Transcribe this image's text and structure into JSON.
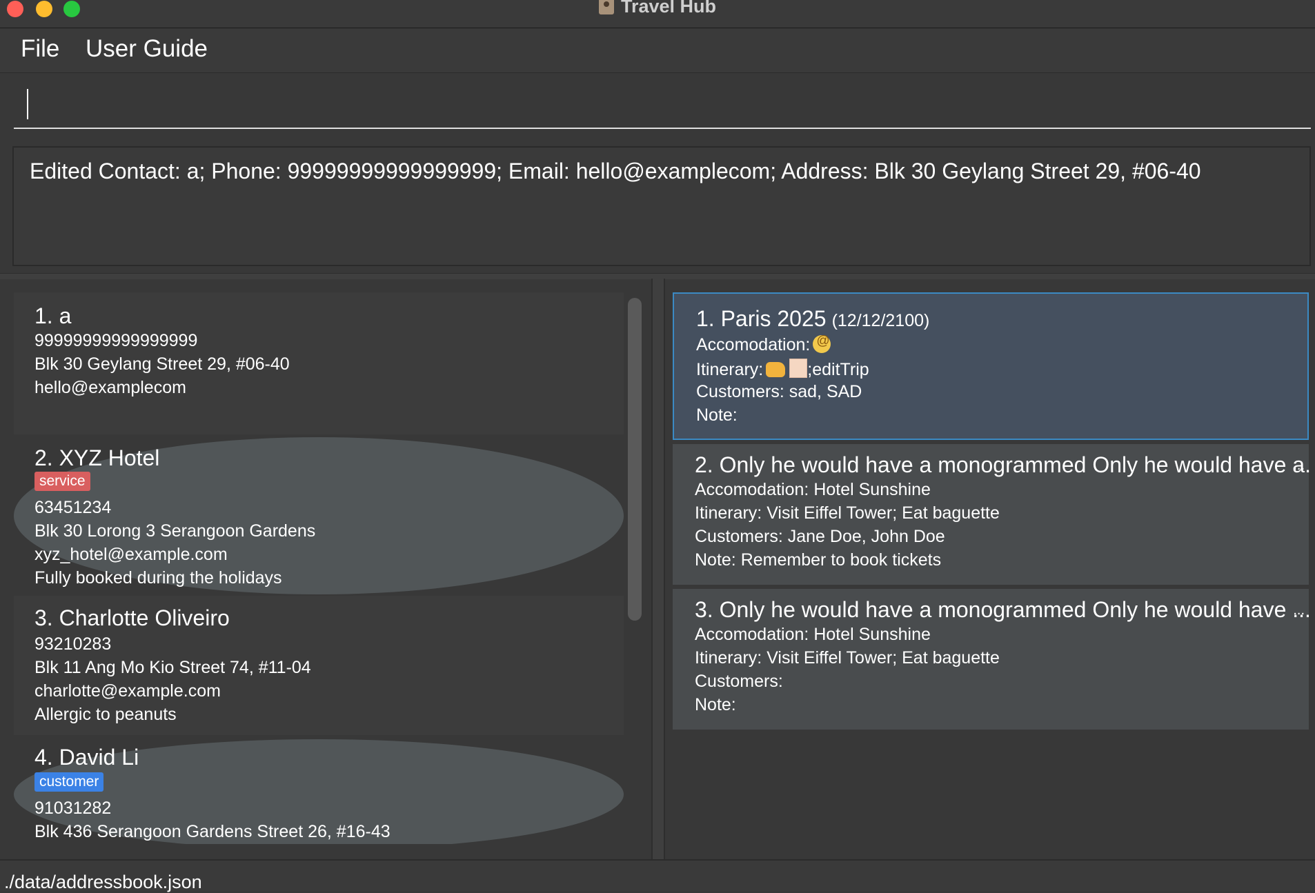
{
  "window": {
    "title": "Travel Hub",
    "app_icon": "contact-book-icon"
  },
  "menu": {
    "file": "File",
    "user_guide": "User Guide"
  },
  "command_box": {
    "value": ""
  },
  "result": {
    "text": "Edited Contact: a; Phone: 99999999999999999; Email: hello@examplecom; Address: Blk 30 Geylang Street 29, #06-40"
  },
  "contacts": [
    {
      "name": "1. a",
      "phone": "99999999999999999",
      "address": "Blk 30 Geylang Street 29, #06-40",
      "email": "hello@examplecom"
    },
    {
      "name": "2. XYZ Hotel",
      "tag": "service",
      "phone": "63451234",
      "address": "Blk 30 Lorong 3 Serangoon Gardens",
      "email": "xyz_hotel@example.com",
      "note": "Fully booked during the holidays"
    },
    {
      "name": "3. Charlotte Oliveiro",
      "phone": "93210283",
      "address": "Blk 11 Ang Mo Kio Street 74, #11-04",
      "email": "charlotte@example.com",
      "note": "Allergic to peanuts"
    },
    {
      "name": "4. David Li",
      "tag": "customer",
      "phone": "91031282",
      "address": "Blk 436 Serangoon Gardens Street 26, #16-43"
    }
  ],
  "trips": [
    {
      "title": "1.  Paris 2025",
      "date": "(12/12/2100)",
      "accomodation": "Accomodation:",
      "itinerary_label": "Itinerary:",
      "itinerary_text": ";editTrip",
      "customers": "Customers: sad, SAD",
      "note": "Note:"
    },
    {
      "title": "2.  Only he would have a monogrammed Only he would have a...",
      "ellipsis": "...",
      "accomodation": "Accomodation: Hotel Sunshine",
      "itinerary": "Itinerary: Visit Eiffel Tower; Eat baguette",
      "customers": "Customers: Jane Doe, John Doe",
      "note": "Note: Remember to book tickets"
    },
    {
      "title": "3.  Only he would have a monogrammed Only he would have ...",
      "ellipsis": "...",
      "accomodation": "Accomodation: Hotel Sunshine",
      "itinerary": "Itinerary: Visit Eiffel Tower; Eat baguette",
      "customers": "Customers:",
      "note": "Note:"
    }
  ],
  "status": {
    "path": "./data/addressbook.json"
  }
}
